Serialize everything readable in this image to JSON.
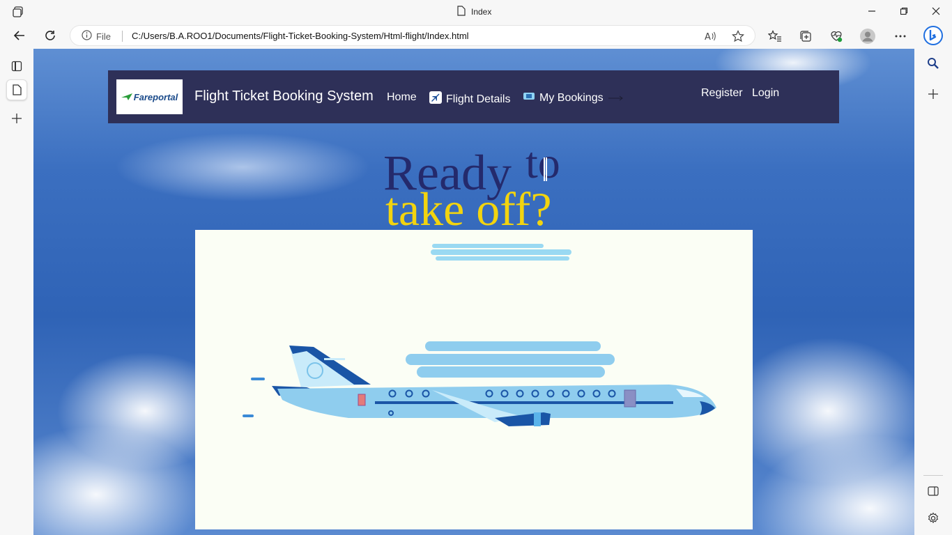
{
  "browser": {
    "tab_title": "Index",
    "address_label": "File",
    "url": "C:/Users/B.A.ROO1/Documents/Flight-Ticket-Booking-System/Html-flight/Index.html"
  },
  "navbar": {
    "logo_text": "Fareportal",
    "brand": "Flight Ticket Booking System",
    "links": {
      "home": "Home",
      "flight_details": "Flight Details",
      "my_bookings": "My Bookings"
    },
    "register": "Register",
    "login": "Login"
  },
  "hero": {
    "line1": "Ready",
    "line1_to": "to",
    "line2": "take off?"
  },
  "colors": {
    "navbar_bg": "#2e3058",
    "headline_dark": "#242a6c",
    "headline_accent": "#f2d40f",
    "plane_body": "#8fcdee",
    "plane_dark": "#1a55a6"
  }
}
